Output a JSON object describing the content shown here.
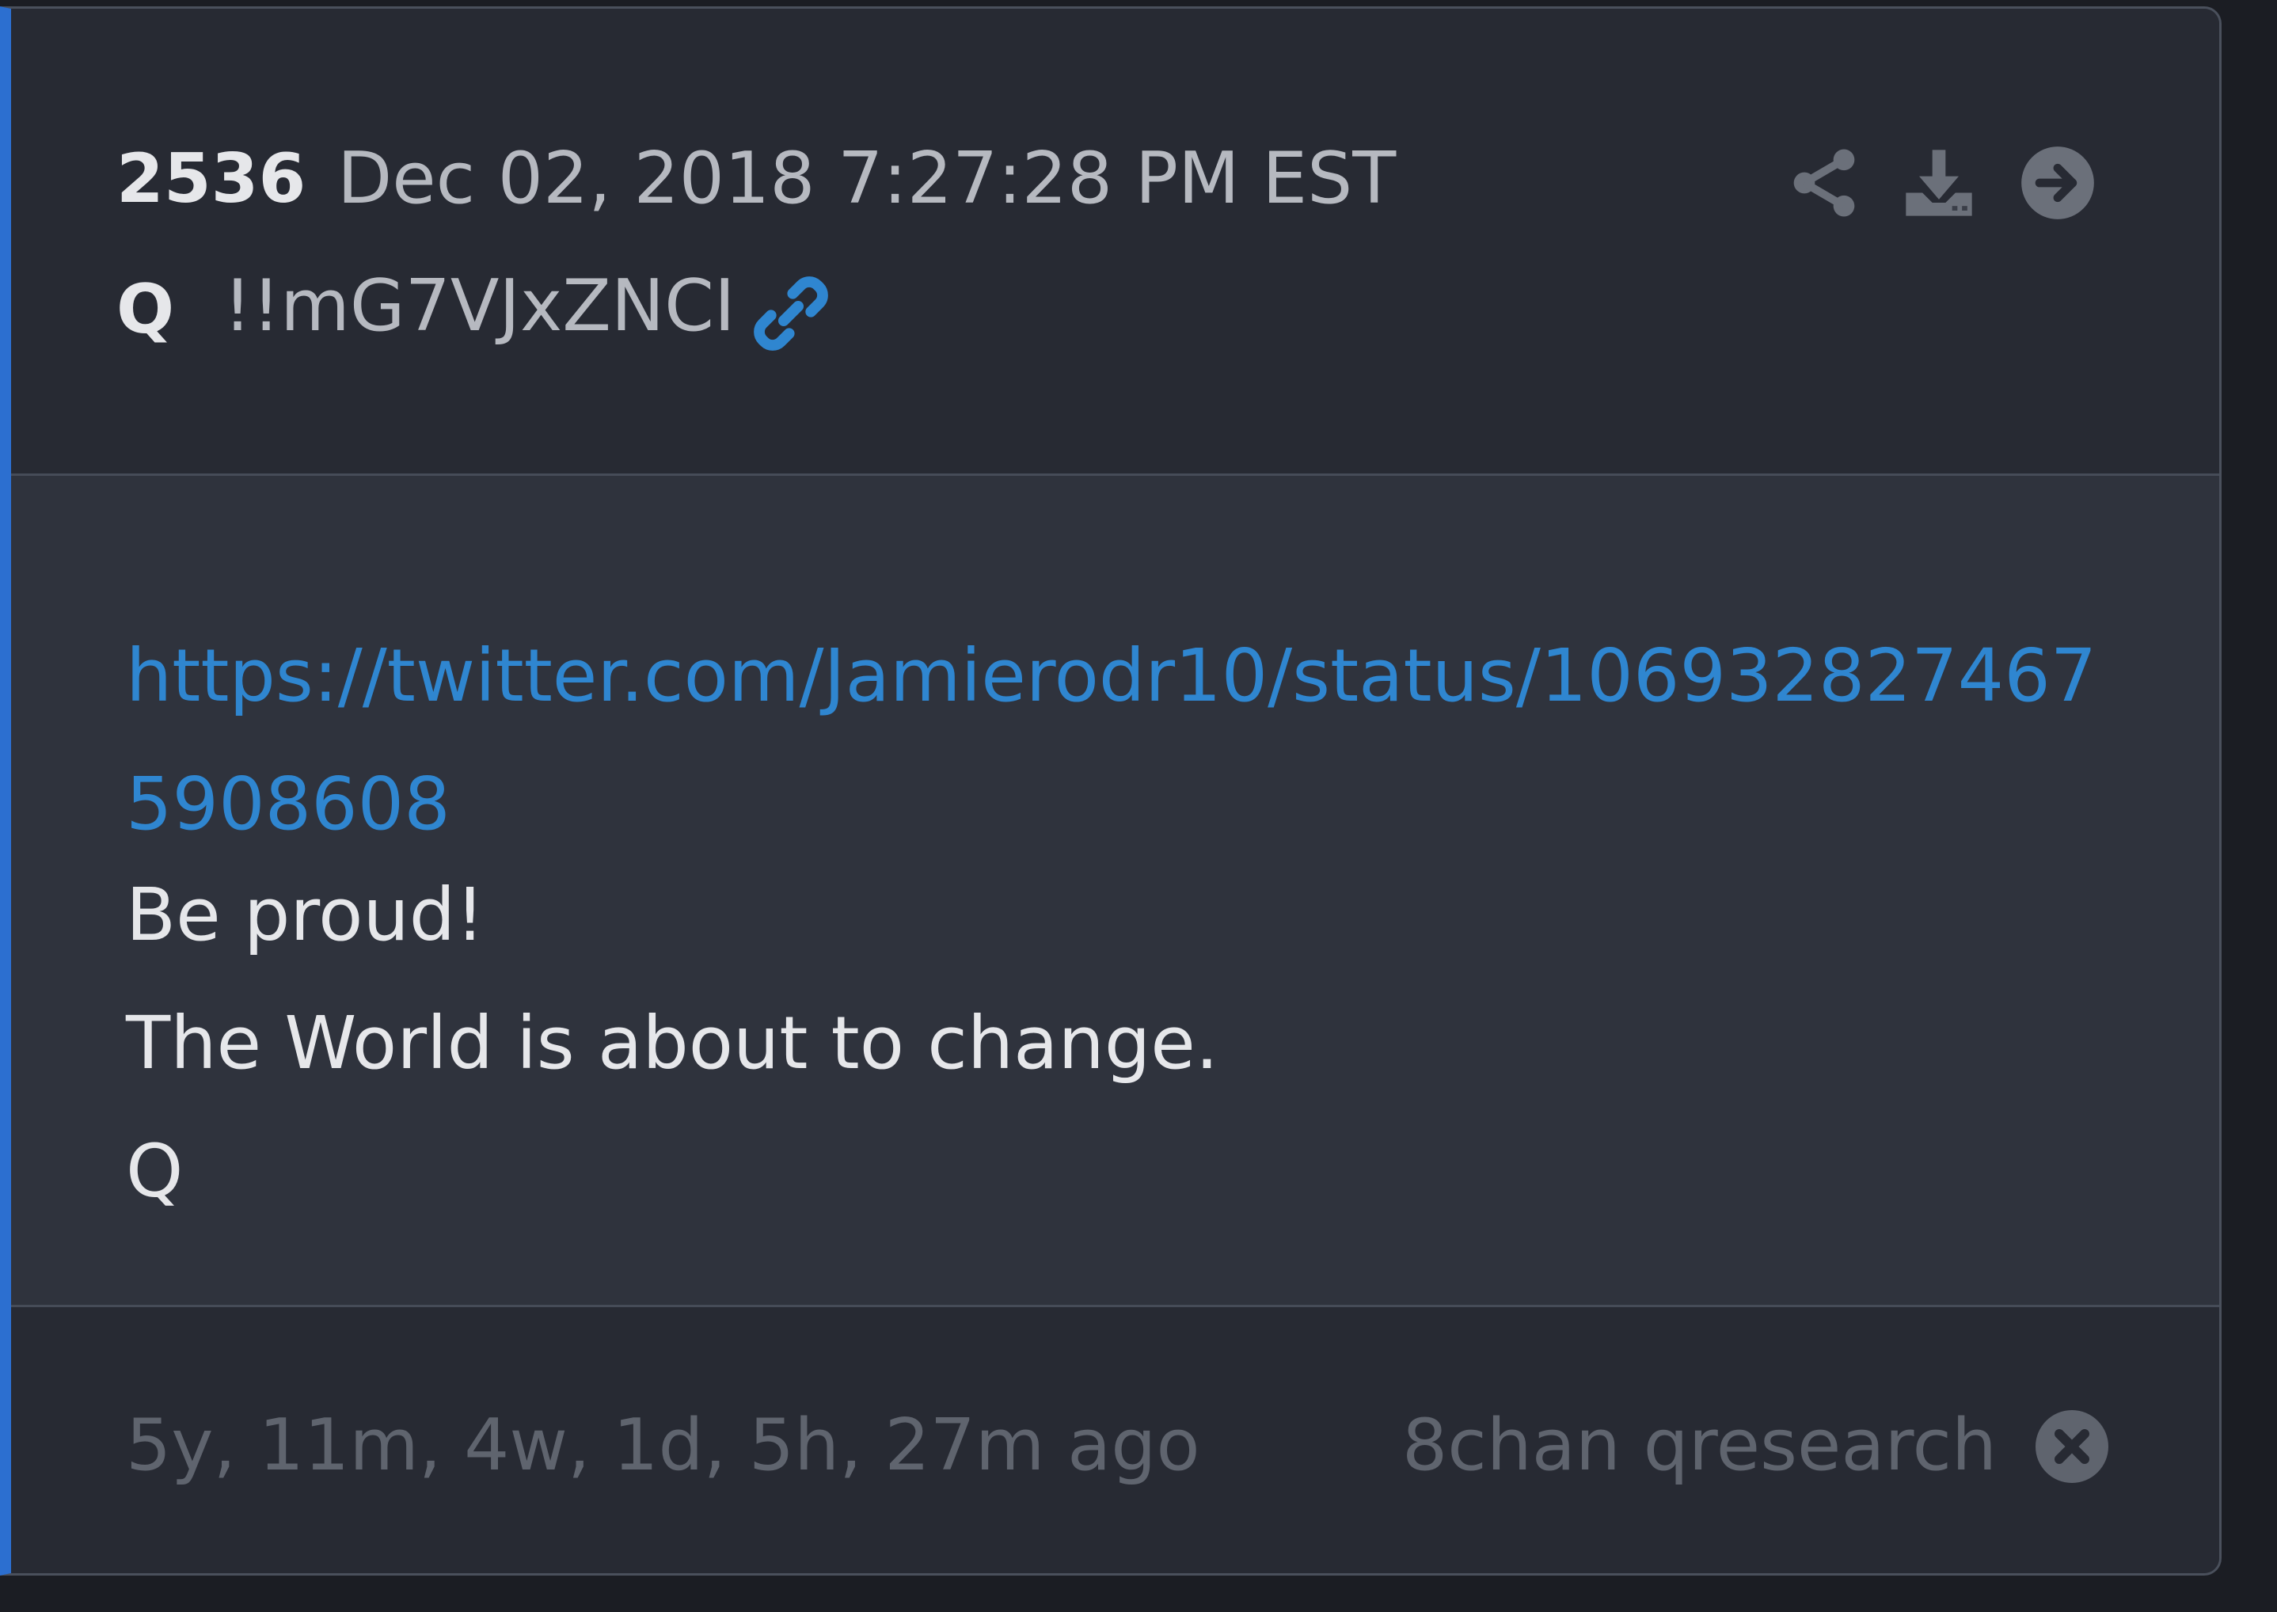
{
  "post": {
    "number": "2536",
    "date": "Dec 02, 2018 7:27:28 PM EST",
    "author": "Q",
    "tripcode": "!!mG7VJxZNCI",
    "link": "https://twitter.com/Jamierodr10/status/1069328274675908608",
    "lines": [
      "Be proud!",
      "The World is about to change.",
      "Q"
    ]
  },
  "footer": {
    "time_ago": "5y, 11m, 4w, 1d, 5h, 27m ago",
    "source": "8chan qresearch"
  },
  "icons": {
    "link": "link-icon",
    "share": "share-icon",
    "download": "download-icon",
    "forward": "arrow-circle-right-icon",
    "close": "close-circle-icon"
  },
  "colors": {
    "accent": "#2c6fd0",
    "link": "#2f86d0",
    "header_bg": "#272a33",
    "body_bg": "#2f333d",
    "muted_text": "#5f646e"
  }
}
